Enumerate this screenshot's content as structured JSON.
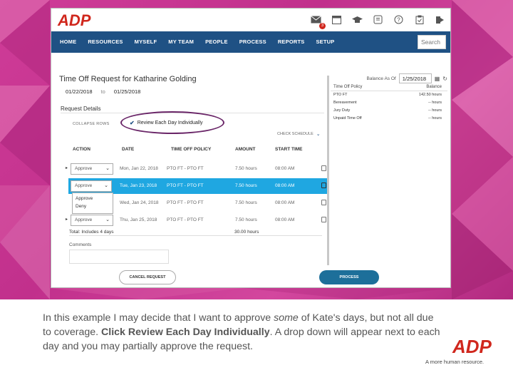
{
  "app": {
    "logo_text": "ADP",
    "tagline": "A more human resource."
  },
  "top_icons": [
    {
      "name": "envelope-icon",
      "badge": "3"
    },
    {
      "name": "calendar-icon",
      "badge": ""
    },
    {
      "name": "graduation-cap-icon",
      "badge": ""
    },
    {
      "name": "document-icon",
      "badge": ""
    },
    {
      "name": "help-icon",
      "badge": ""
    },
    {
      "name": "clipboard-icon",
      "badge": ""
    },
    {
      "name": "logout-icon",
      "badge": ""
    }
  ],
  "nav": {
    "items": [
      "HOME",
      "RESOURCES",
      "MYSELF",
      "MY TEAM",
      "PEOPLE",
      "PROCESS",
      "REPORTS",
      "SETUP"
    ],
    "search_label": "Search"
  },
  "page": {
    "title": "Time Off Request for Katharine Golding",
    "start_date": "01/22/2018",
    "to_label": "to",
    "end_date": "01/25/2018",
    "request_details": "Request Details",
    "collapse_rows": "COLLAPSE ROWS",
    "review_label": "Review Each Day Individually",
    "check_schedule": "CHECK SCHEDULE"
  },
  "table": {
    "headers": [
      "ACTION",
      "DATE",
      "TIME OFF POLICY",
      "AMOUNT",
      "START TIME"
    ],
    "rows": [
      {
        "action": "Approve",
        "date": "Mon, Jan 22, 2018",
        "policy": "PTO FT - PTO FT",
        "amount": "7.50 hours",
        "start": "08:00 AM"
      },
      {
        "action": "Approve",
        "date": "Tue, Jan 23, 2018",
        "policy": "PTO FT - PTO FT",
        "amount": "7.50 hours",
        "start": "08:00 AM"
      },
      {
        "action": "Approve",
        "date": "Wed, Jan 24, 2018",
        "policy": "PTO FT - PTO FT",
        "amount": "7.50 hours",
        "start": "08:00 AM"
      },
      {
        "action": "Approve",
        "date": "Thu, Jan 25, 2018",
        "policy": "PTO FT - PTO FT",
        "amount": "7.50 hours",
        "start": "08:00 AM"
      }
    ],
    "dropdown_options": [
      "Approve",
      "Deny"
    ],
    "total_label": "Total: Includes 4 days",
    "total_hours": "30.00 hours",
    "comments_label": "Comments"
  },
  "buttons": {
    "cancel": "CANCEL REQUEST",
    "process": "PROCESS"
  },
  "balance": {
    "as_of_label": "Balance As Of",
    "as_of_date": "1/25/2018",
    "col_policy": "Time Off Policy",
    "col_balance": "Balance",
    "rows": [
      {
        "policy": "PTO FT",
        "balance": "142.50 hours"
      },
      {
        "policy": "Bereavement",
        "balance": "-- hours"
      },
      {
        "policy": "Jury Duty",
        "balance": "-- hours"
      },
      {
        "policy": "Unpaid Time Off",
        "balance": "-- hours"
      }
    ]
  },
  "caption": {
    "part1": "In this example I may decide that I want to approve ",
    "emph": "some",
    "part2": " of Kate's days, but not all due to coverage. ",
    "bold": "Click Review Each Day Individually",
    "part3": ". A drop down will appear next to each day and you may partially approve the request."
  },
  "colors": {
    "nav_bg": "#1f5184",
    "selected_row": "#1fa7e1",
    "process_btn": "#1d6f9a",
    "adp_red": "#d0271d",
    "slide_bg": "#c1308c",
    "highlight_circle": "#6a2668"
  }
}
